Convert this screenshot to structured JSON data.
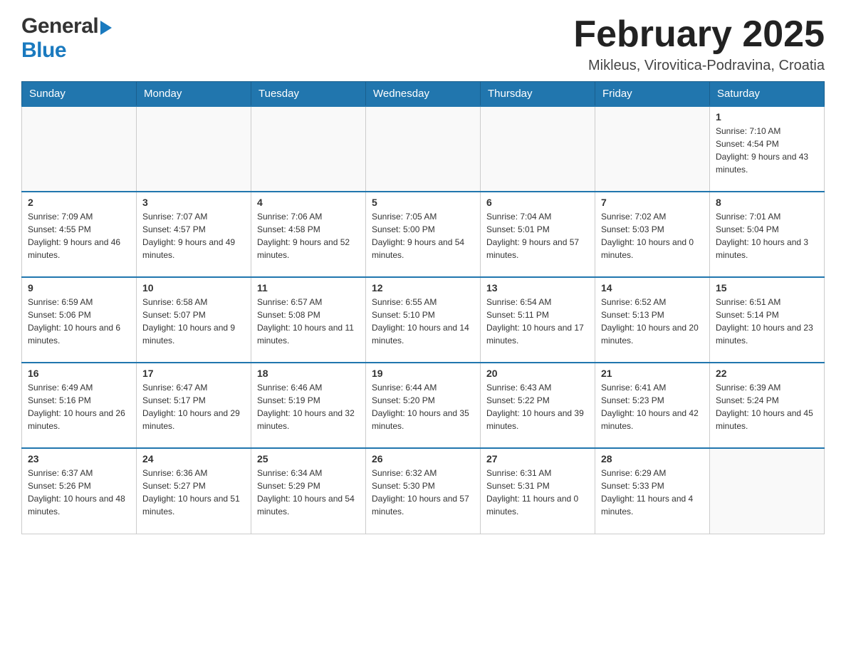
{
  "header": {
    "logo_general": "General",
    "logo_blue": "Blue",
    "month_title": "February 2025",
    "location": "Mikleus, Virovitica-Podravina, Croatia"
  },
  "weekdays": [
    "Sunday",
    "Monday",
    "Tuesday",
    "Wednesday",
    "Thursday",
    "Friday",
    "Saturday"
  ],
  "weeks": [
    [
      {
        "day": "",
        "info": ""
      },
      {
        "day": "",
        "info": ""
      },
      {
        "day": "",
        "info": ""
      },
      {
        "day": "",
        "info": ""
      },
      {
        "day": "",
        "info": ""
      },
      {
        "day": "",
        "info": ""
      },
      {
        "day": "1",
        "info": "Sunrise: 7:10 AM\nSunset: 4:54 PM\nDaylight: 9 hours and 43 minutes."
      }
    ],
    [
      {
        "day": "2",
        "info": "Sunrise: 7:09 AM\nSunset: 4:55 PM\nDaylight: 9 hours and 46 minutes."
      },
      {
        "day": "3",
        "info": "Sunrise: 7:07 AM\nSunset: 4:57 PM\nDaylight: 9 hours and 49 minutes."
      },
      {
        "day": "4",
        "info": "Sunrise: 7:06 AM\nSunset: 4:58 PM\nDaylight: 9 hours and 52 minutes."
      },
      {
        "day": "5",
        "info": "Sunrise: 7:05 AM\nSunset: 5:00 PM\nDaylight: 9 hours and 54 minutes."
      },
      {
        "day": "6",
        "info": "Sunrise: 7:04 AM\nSunset: 5:01 PM\nDaylight: 9 hours and 57 minutes."
      },
      {
        "day": "7",
        "info": "Sunrise: 7:02 AM\nSunset: 5:03 PM\nDaylight: 10 hours and 0 minutes."
      },
      {
        "day": "8",
        "info": "Sunrise: 7:01 AM\nSunset: 5:04 PM\nDaylight: 10 hours and 3 minutes."
      }
    ],
    [
      {
        "day": "9",
        "info": "Sunrise: 6:59 AM\nSunset: 5:06 PM\nDaylight: 10 hours and 6 minutes."
      },
      {
        "day": "10",
        "info": "Sunrise: 6:58 AM\nSunset: 5:07 PM\nDaylight: 10 hours and 9 minutes."
      },
      {
        "day": "11",
        "info": "Sunrise: 6:57 AM\nSunset: 5:08 PM\nDaylight: 10 hours and 11 minutes."
      },
      {
        "day": "12",
        "info": "Sunrise: 6:55 AM\nSunset: 5:10 PM\nDaylight: 10 hours and 14 minutes."
      },
      {
        "day": "13",
        "info": "Sunrise: 6:54 AM\nSunset: 5:11 PM\nDaylight: 10 hours and 17 minutes."
      },
      {
        "day": "14",
        "info": "Sunrise: 6:52 AM\nSunset: 5:13 PM\nDaylight: 10 hours and 20 minutes."
      },
      {
        "day": "15",
        "info": "Sunrise: 6:51 AM\nSunset: 5:14 PM\nDaylight: 10 hours and 23 minutes."
      }
    ],
    [
      {
        "day": "16",
        "info": "Sunrise: 6:49 AM\nSunset: 5:16 PM\nDaylight: 10 hours and 26 minutes."
      },
      {
        "day": "17",
        "info": "Sunrise: 6:47 AM\nSunset: 5:17 PM\nDaylight: 10 hours and 29 minutes."
      },
      {
        "day": "18",
        "info": "Sunrise: 6:46 AM\nSunset: 5:19 PM\nDaylight: 10 hours and 32 minutes."
      },
      {
        "day": "19",
        "info": "Sunrise: 6:44 AM\nSunset: 5:20 PM\nDaylight: 10 hours and 35 minutes."
      },
      {
        "day": "20",
        "info": "Sunrise: 6:43 AM\nSunset: 5:22 PM\nDaylight: 10 hours and 39 minutes."
      },
      {
        "day": "21",
        "info": "Sunrise: 6:41 AM\nSunset: 5:23 PM\nDaylight: 10 hours and 42 minutes."
      },
      {
        "day": "22",
        "info": "Sunrise: 6:39 AM\nSunset: 5:24 PM\nDaylight: 10 hours and 45 minutes."
      }
    ],
    [
      {
        "day": "23",
        "info": "Sunrise: 6:37 AM\nSunset: 5:26 PM\nDaylight: 10 hours and 48 minutes."
      },
      {
        "day": "24",
        "info": "Sunrise: 6:36 AM\nSunset: 5:27 PM\nDaylight: 10 hours and 51 minutes."
      },
      {
        "day": "25",
        "info": "Sunrise: 6:34 AM\nSunset: 5:29 PM\nDaylight: 10 hours and 54 minutes."
      },
      {
        "day": "26",
        "info": "Sunrise: 6:32 AM\nSunset: 5:30 PM\nDaylight: 10 hours and 57 minutes."
      },
      {
        "day": "27",
        "info": "Sunrise: 6:31 AM\nSunset: 5:31 PM\nDaylight: 11 hours and 0 minutes."
      },
      {
        "day": "28",
        "info": "Sunrise: 6:29 AM\nSunset: 5:33 PM\nDaylight: 11 hours and 4 minutes."
      },
      {
        "day": "",
        "info": ""
      }
    ]
  ]
}
